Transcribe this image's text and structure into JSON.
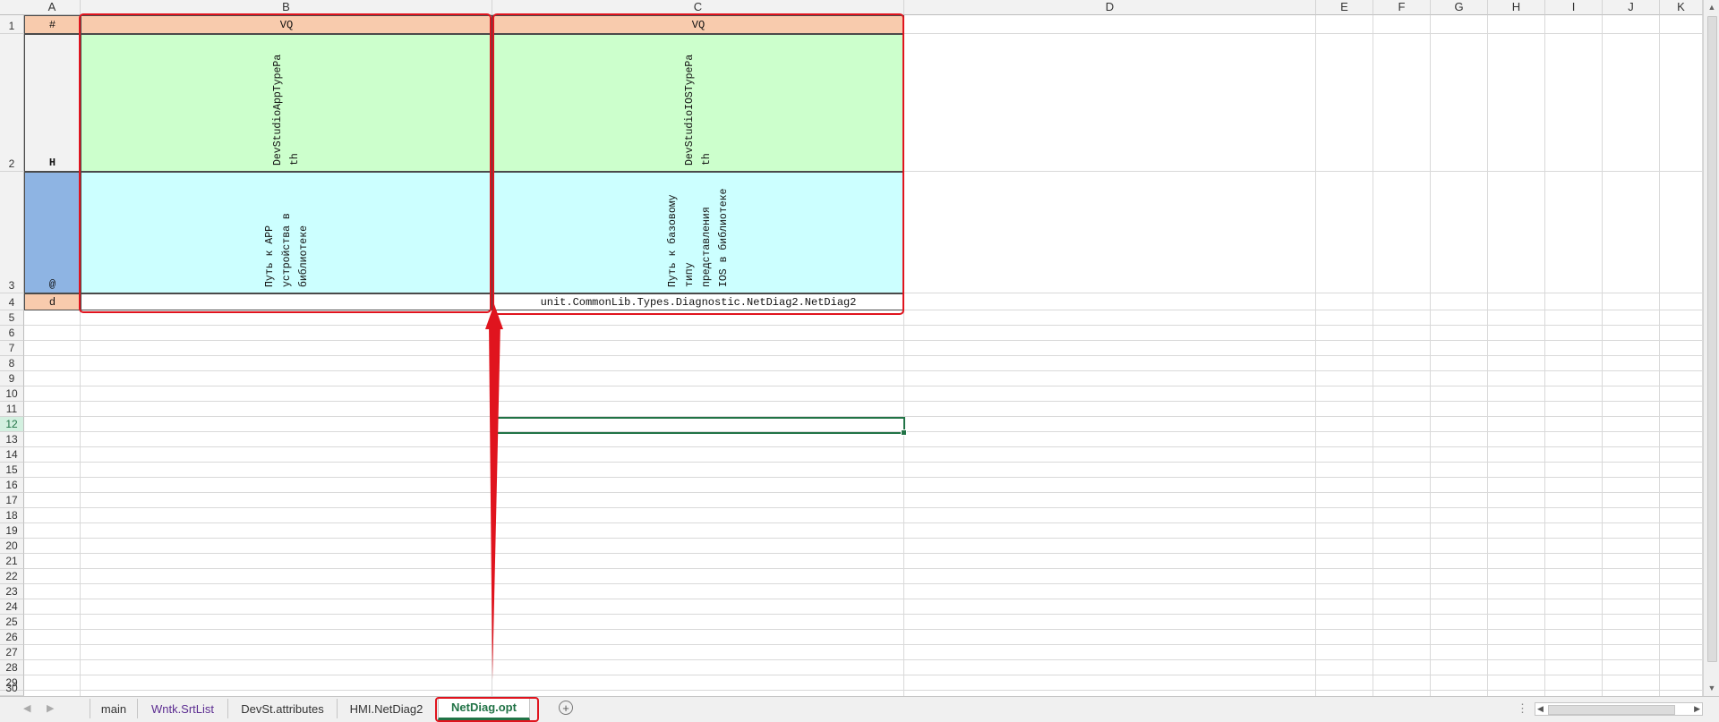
{
  "columns": [
    "A",
    "B",
    "C",
    "D",
    "E",
    "F",
    "G",
    "H",
    "I",
    "J",
    "K"
  ],
  "rows": [
    "1",
    "2",
    "3",
    "4",
    "5",
    "6",
    "7",
    "8",
    "9",
    "10",
    "11",
    "12",
    "13",
    "14",
    "15",
    "16",
    "17",
    "18",
    "19",
    "20",
    "21",
    "22",
    "23",
    "24",
    "25",
    "26",
    "27",
    "28",
    "29",
    "30"
  ],
  "selected_row": "12",
  "cells": {
    "A1": "#",
    "A2": "H",
    "A3": "@",
    "A4": "d",
    "B1": "VQ",
    "C1": "VQ",
    "B2_lines": [
      "DevStudioAppTypePa",
      "th"
    ],
    "C2_lines": [
      "DevStudioIOSTypePa",
      "th"
    ],
    "B3_lines": [
      "Путь к APP",
      "устройства в",
      "библиотеке"
    ],
    "C3_lines": [
      "Путь к базовому",
      "типу",
      "представления",
      "IOS в библиотеке"
    ],
    "C4": "unit.CommonLib.Types.Diagnostic.NetDiag2.NetDiag2"
  },
  "colors": {
    "header_orange": "#f8cbad",
    "green_fill": "#ccffcc",
    "cyan_fill": "#ccffff",
    "blue_fill": "#8eb4e3",
    "annotation_red": "#e0141e",
    "excel_green": "#217346"
  },
  "tabs": [
    {
      "label": "main",
      "active": false
    },
    {
      "label": "Wntk.SrtList",
      "active": false
    },
    {
      "label": "DevSt.attributes",
      "active": false
    },
    {
      "label": "HMI.NetDiag2",
      "active": false
    },
    {
      "label": "NetDiag.opt",
      "active": true
    }
  ],
  "icons": {
    "add_sheet": "plus-circle-icon",
    "nav_prev": "triangle-left-icon",
    "nav_next": "triangle-right-icon",
    "more_options": "ellipsis-icon"
  }
}
